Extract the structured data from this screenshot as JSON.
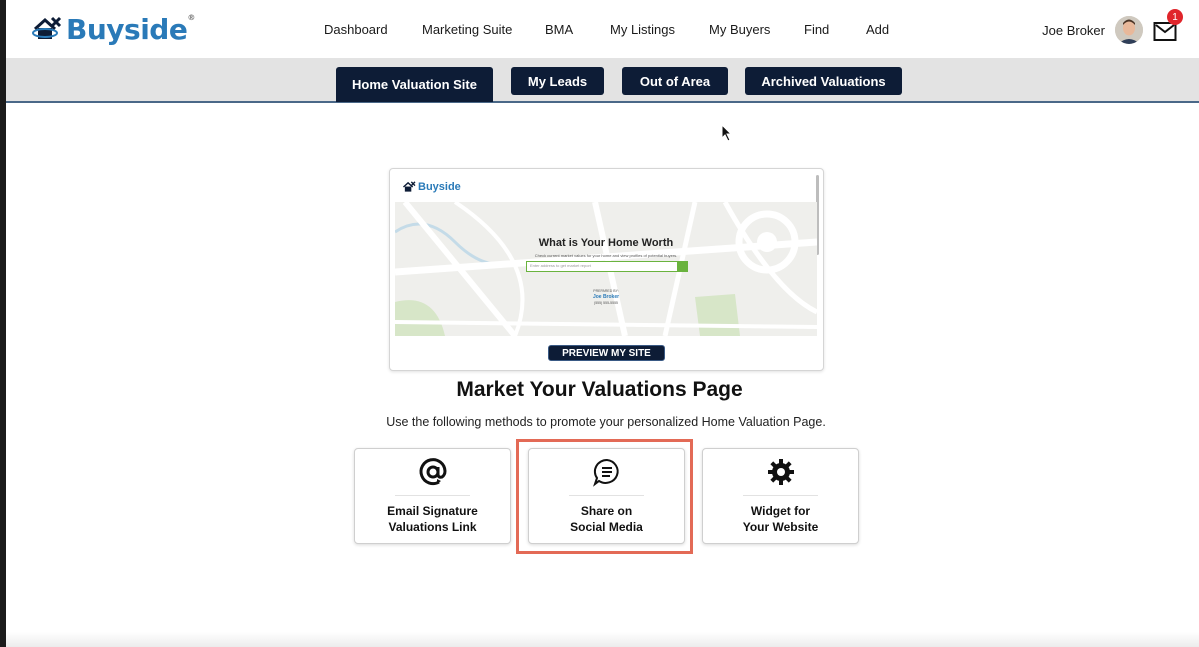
{
  "brand": {
    "name": "Buyside",
    "logo_color": "#2a7ab8"
  },
  "nav": {
    "items": [
      {
        "label": "Dashboard"
      },
      {
        "label": "Marketing Suite"
      },
      {
        "label": "BMA"
      },
      {
        "label": "My Listings"
      },
      {
        "label": "My Buyers"
      },
      {
        "label": "Find"
      },
      {
        "label": "Add"
      }
    ]
  },
  "user": {
    "name": "Joe Broker",
    "notification_count": "1"
  },
  "tabs": [
    {
      "label": "Home Valuation Site",
      "active": true
    },
    {
      "label": "My Leads",
      "active": false
    },
    {
      "label": "Out of Area",
      "active": false
    },
    {
      "label": "Archived Valuations",
      "active": false
    }
  ],
  "preview": {
    "logo_text": "Buyside",
    "headline": "What is Your Home Worth",
    "subline": "Check current market values for your home and view profiles of potential buyers.",
    "search_placeholder": "Enter address to get market report",
    "prepared_by_label": "PREPARED BY:",
    "agent_name": "Joe Broker",
    "agent_phone": "(555) 555-5555",
    "button_label": "PREVIEW MY SITE"
  },
  "main": {
    "title": "Market Your Valuations Page",
    "subtitle": "Use the following methods to promote your personalized Home Valuation Page."
  },
  "methods": [
    {
      "line1": "Email Signature",
      "line2": "Valuations Link",
      "icon": "at-icon"
    },
    {
      "line1": "Share on",
      "line2": "Social Media",
      "icon": "chat-bubble-icon",
      "highlighted": true
    },
    {
      "line1": "Widget for",
      "line2": "Your Website",
      "icon": "gear-icon"
    }
  ],
  "colors": {
    "navy": "#0d1c36",
    "highlight": "#e36a56",
    "badge": "#e0252b",
    "search_green": "#6ab33e"
  }
}
